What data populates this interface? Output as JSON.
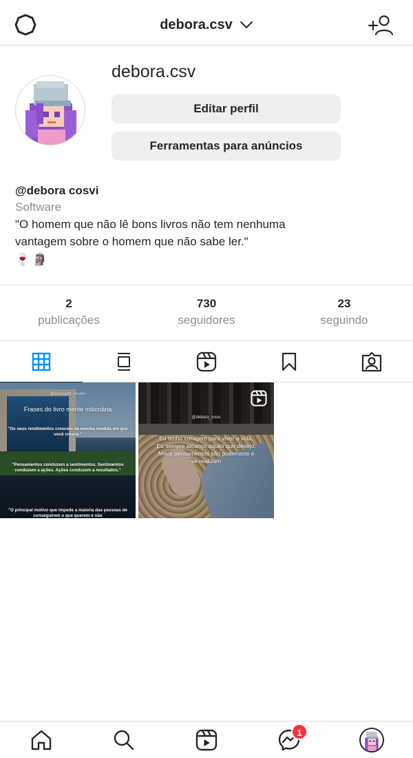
{
  "topbar": {
    "username": "debora.csv",
    "icons": {
      "left": "settings-icon",
      "switch": "chevron-down-icon",
      "right": "add-user-icon"
    }
  },
  "profile": {
    "name": "debora.csv",
    "buttons": {
      "edit": "Editar perfil",
      "ads": "Ferramentas para anúncios"
    },
    "avatar": "pixel-art-avatar"
  },
  "bio": {
    "handle": "@debora cosvi",
    "category": "Software",
    "text": "\"O homem que não lê bons livros não tem nenhuma vantagem sobre o homem que não sabe ler.\"",
    "emoji_1": "🍷",
    "emoji_2": "🗿"
  },
  "stats": [
    {
      "value": "2",
      "label": "publicações"
    },
    {
      "value": "730",
      "label": "seguidores"
    },
    {
      "value": "23",
      "label": "seguindo"
    }
  ],
  "tabs": [
    {
      "icon": "grid-icon",
      "active": true
    },
    {
      "icon": "guide-icon",
      "active": false
    },
    {
      "icon": "reels-icon",
      "active": false
    },
    {
      "icon": "bookmark-icon",
      "active": false
    },
    {
      "icon": "tagged-icon",
      "active": false
    }
  ],
  "posts": [
    {
      "handle": "@eusouorh_oculos",
      "title": "Frases do livro mente milionária",
      "quotes": [
        "\"Os seus rendimentos crescem na mesma medida em que você cresce.\"",
        "\"Pensamentos conduzem a sentimentos. Sentimentos conduzem a ações. Ações conduzem a resultados.\"",
        "\"O principal motivo que impede a maioria das pessoas de conseguirem o que querem é não"
      ]
    },
    {
      "handle": "@debora_cosvi",
      "text": "Eu tenho coragem para viver a vida.\nEu sempre alcanço aquilo que desejo.\nMeus pensamentos são poderosos e se realizam",
      "badge_icon": "reel-icon"
    }
  ],
  "bottomnav": {
    "items": [
      "home-icon",
      "search-icon",
      "reels-icon",
      "messenger-icon",
      "profile-avatar"
    ],
    "messenger_badge": "1"
  },
  "colors": {
    "accent": "#0095f6",
    "text": "#262626",
    "muted": "#8e8e8e",
    "badge": "#ff3040",
    "border": "#dbdbdb",
    "button_bg": "#efefef"
  }
}
